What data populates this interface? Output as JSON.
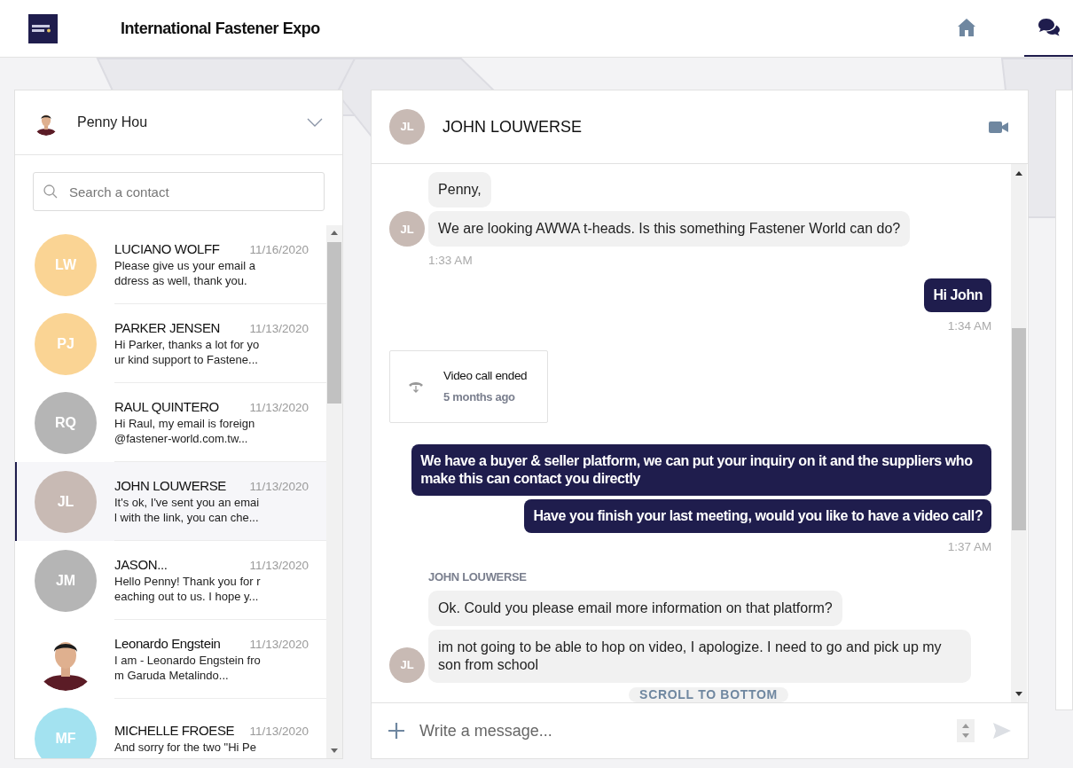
{
  "header": {
    "title": "International Fastener Expo",
    "nav": [
      {
        "kind": "home",
        "selected": false
      },
      {
        "kind": "chat",
        "selected": true
      }
    ]
  },
  "user": {
    "name": "Penny Hou"
  },
  "search": {
    "placeholder": "Search a contact"
  },
  "contacts": [
    {
      "initials": "LW",
      "color": "#fad494",
      "name": "LUCIANO WOLFF",
      "date": "11/16/2020",
      "preview": "Please give us your email address as well, thank you.",
      "selected": false
    },
    {
      "initials": "PJ",
      "color": "#fad494",
      "name": "PARKER JENSEN",
      "date": "11/13/2020",
      "preview": "Hi Parker, thanks a lot for your kind support to Fastene...",
      "selected": false
    },
    {
      "initials": "RQ",
      "color": "#b5b5b5",
      "name": "RAUL QUINTERO",
      "date": "11/13/2020",
      "preview": "Hi Raul, my email is foreign @fastener-world.com.tw...",
      "selected": false
    },
    {
      "initials": "JL",
      "color": "#c8bab4",
      "name": "JOHN LOUWERSE",
      "date": "11/13/2020",
      "preview": "It's ok, I've sent you an email with the link, you can che...",
      "selected": true
    },
    {
      "initials": "JM",
      "color": "#b5b5b5",
      "name": "JASON...",
      "date": "11/13/2020",
      "preview": "Hello Penny! Thank you for reaching out to us. I hope y...",
      "selected": false
    },
    {
      "kind": "picture",
      "name": "Leonardo Engstein",
      "date": "11/13/2020",
      "preview": "I am - Leonardo Engstein from Garuda Metalindo...",
      "selected": false
    },
    {
      "initials": "MF",
      "color": "#a3e2f0",
      "name": "MICHELLE FROESE",
      "date": "11/13/2020",
      "preview": "And sorry for the two \"Hi Pe",
      "selected": false
    }
  ],
  "chat": {
    "initials": "JL",
    "name": "JOHN LOUWERSE",
    "messages": [
      {
        "kind": "in",
        "text": "Penny,"
      },
      {
        "kind": "in",
        "text": "We are looking AWWA t-heads. Is this something Fastener World can do?",
        "avatar": "JL"
      },
      {
        "kind": "in_time",
        "text": "1:33 AM"
      },
      {
        "kind": "out",
        "text": "Hi John"
      },
      {
        "kind": "out_time",
        "text": "1:34 AM"
      },
      {
        "kind": "call",
        "title": "Video call ended",
        "subtitle": "5 months ago"
      },
      {
        "kind": "out",
        "text": "We have a buyer & seller platform, we can put your inquiry on it and the suppliers who make this can contact you directly"
      },
      {
        "kind": "out",
        "text": "Have you finish your last meeting, would you like to have a video call?"
      },
      {
        "kind": "out_time",
        "text": "1:37 AM"
      },
      {
        "kind": "sender",
        "text": "JOHN LOUWERSE"
      },
      {
        "kind": "in",
        "text": "Ok. Could you please email more information on that platform?"
      },
      {
        "kind": "in",
        "text": "im not going to be able to hop on video, I apologize. I need to go and pick up my son from school",
        "avatar": "JL"
      }
    ],
    "scroll_button": "SCROLL TO BOTTOM",
    "composer": {
      "placeholder": "Write a message..."
    }
  }
}
